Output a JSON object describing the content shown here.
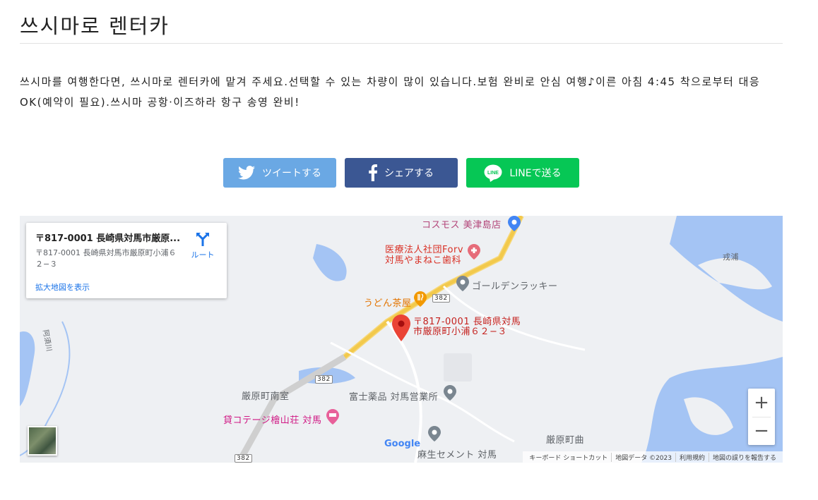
{
  "page": {
    "title": "쓰시마로 렌터카",
    "description": "쓰시마를 여행한다면, 쓰시마로 렌터카에 맡겨 주세요.선택할 수 있는 차량이 많이 있습니다.보험 완비로 안심 여행♪이른 아침 4:45 착으로부터 대응 OK(예약이 필요).쓰시마 공항·이즈하라 항구 송영 완비!"
  },
  "share": {
    "twitter_label": "ツイートする",
    "facebook_label": "シェアする",
    "line_label": "LINEで送る",
    "colors": {
      "twitter": "#6aa8e4",
      "facebook": "#3b5793",
      "line": "#06c755"
    }
  },
  "map": {
    "card": {
      "title": "〒817-0001 長崎県対馬市厳原...",
      "subtitle": "〒817-0001 長崎県対馬市厳原町小浦６２−３",
      "route_label": "ルート",
      "enlarge_link": "拡大地図を表示"
    },
    "marker_label": "〒817-0001 長崎県対馬市厳原町小浦６２−３",
    "places": {
      "cosmos": "コスモス 美津島店",
      "dental": "医療法人社団Forv\n対馬やまねこ歯科",
      "golden": "ゴールデンラッキー",
      "udon": "うどん茶屋",
      "fuji": "富士薬品 対馬営業所",
      "cottage": "貸コテージ檜山荘 対馬",
      "nanmuro": "厳原町南室",
      "magari": "厳原町曲",
      "aso": "麻生セメント 対馬",
      "kaiura": "戎浦",
      "river": "阿須川",
      "route382a": "382",
      "route382b": "382",
      "route382c": "382"
    },
    "google_logo": "Google",
    "attribution": [
      "キーボード ショートカット",
      "地図データ ©2023",
      "利用規約",
      "地図の誤りを報告する"
    ],
    "zoom_in": "+",
    "zoom_out": "−"
  }
}
